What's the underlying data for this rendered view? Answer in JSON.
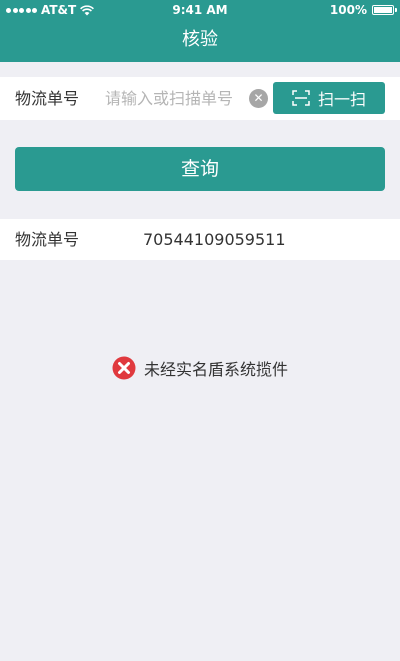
{
  "status_bar": {
    "carrier": "AT&T",
    "time": "9:41 AM",
    "battery": "100%"
  },
  "nav": {
    "title": "核验"
  },
  "search": {
    "label": "物流单号",
    "placeholder": "请输入或扫描单号",
    "value": "",
    "scan_label": "扫一扫"
  },
  "query_button_label": "查询",
  "result": {
    "label": "物流单号",
    "value": "70544109059511"
  },
  "error_message": "未经实名盾系统揽件",
  "colors": {
    "brand": "#2a9a91",
    "error": "#e0393e",
    "background": "#efeff4"
  }
}
